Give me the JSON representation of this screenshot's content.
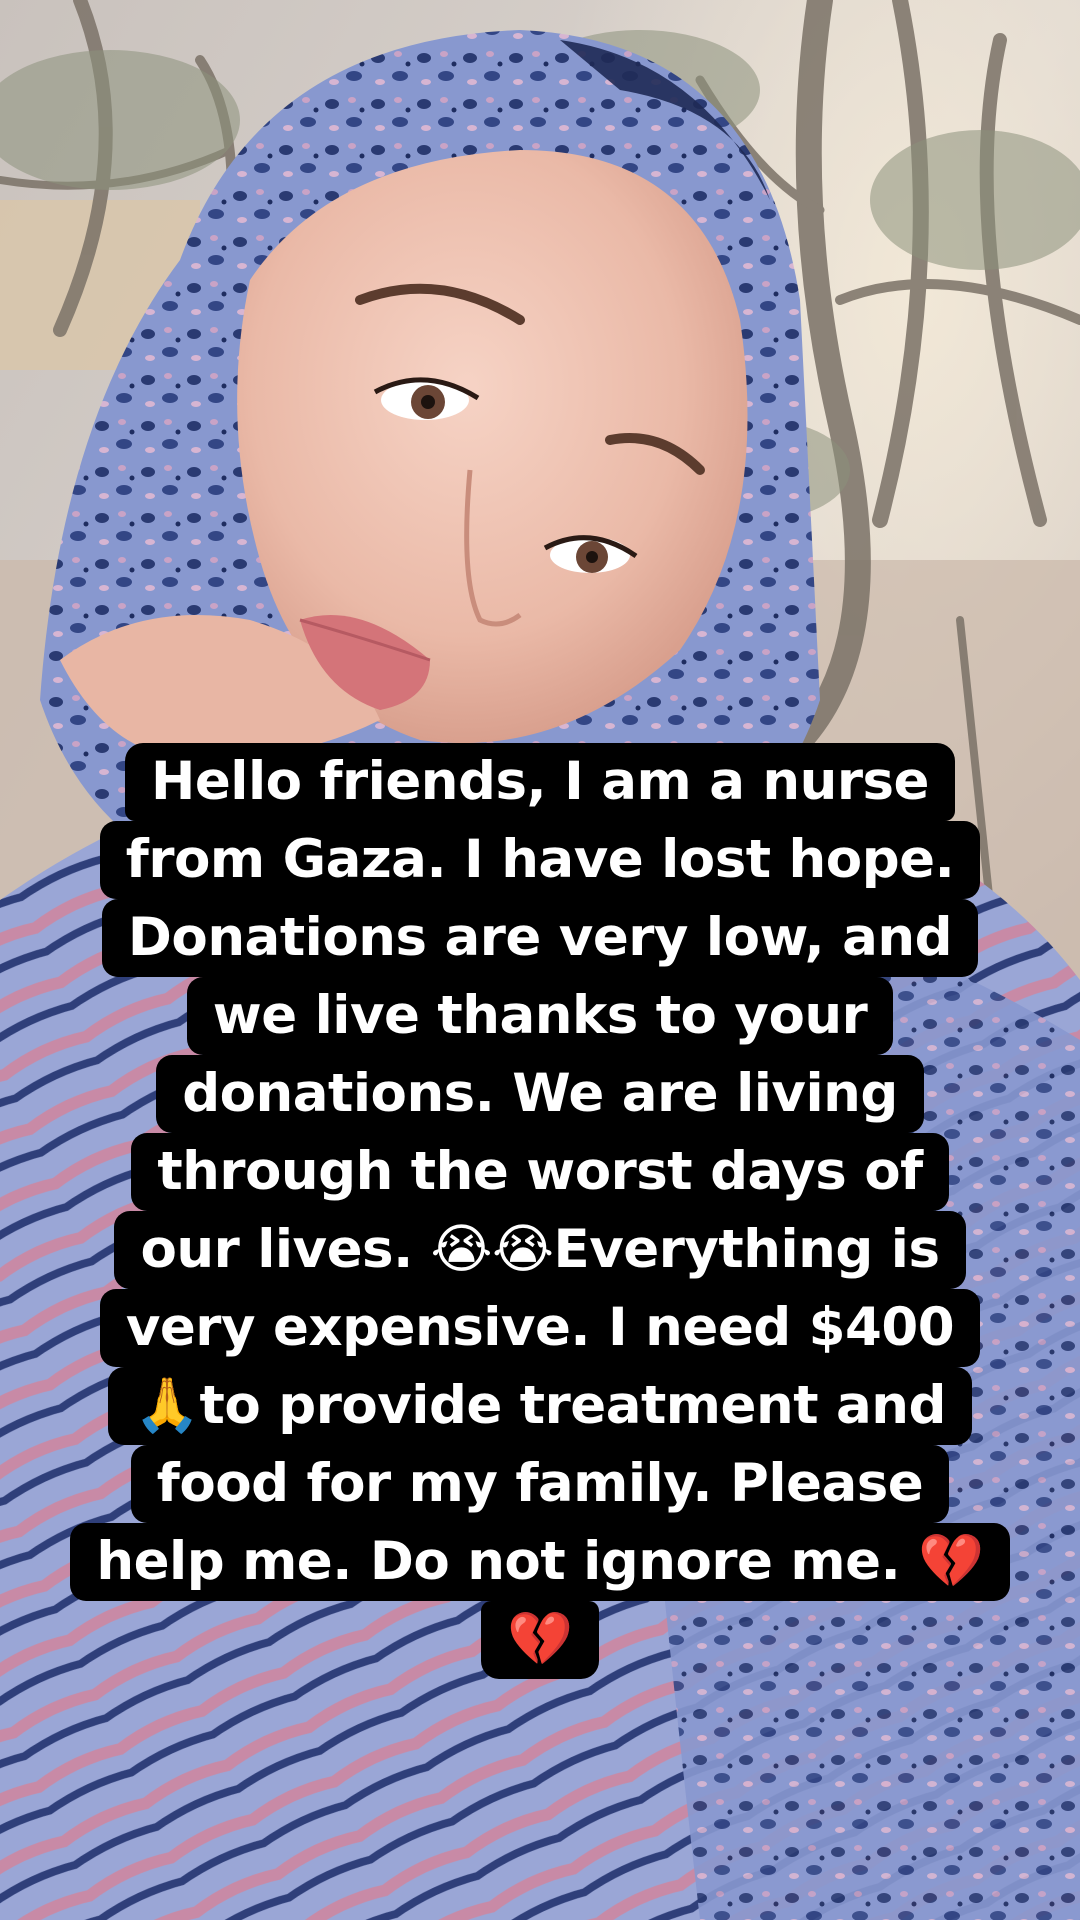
{
  "photo": {
    "description_icon": "portrait-photo",
    "colors": {
      "sky": "#d8d2cf",
      "foliage": "#8b8a7a",
      "headscarf": "#7d8fc4",
      "headscarf_dark": "#28386e",
      "skin": "#efc4b3",
      "lips": "#d47479",
      "caption_bg": "#000000",
      "caption_text": "#ffffff"
    }
  },
  "caption": {
    "lines": [
      "Hello friends, I am a nurse",
      "from Gaza. I have lost hope.",
      "Donations are very low, and",
      "we live thanks to your",
      "donations. We are living",
      "through the worst days of",
      "our lives. 😭😭Everything is",
      "very expensive. I need $400",
      "🙏to provide treatment and",
      "food for my family. Please",
      "help me. Do not ignore me. 💔",
      "💔"
    ]
  }
}
